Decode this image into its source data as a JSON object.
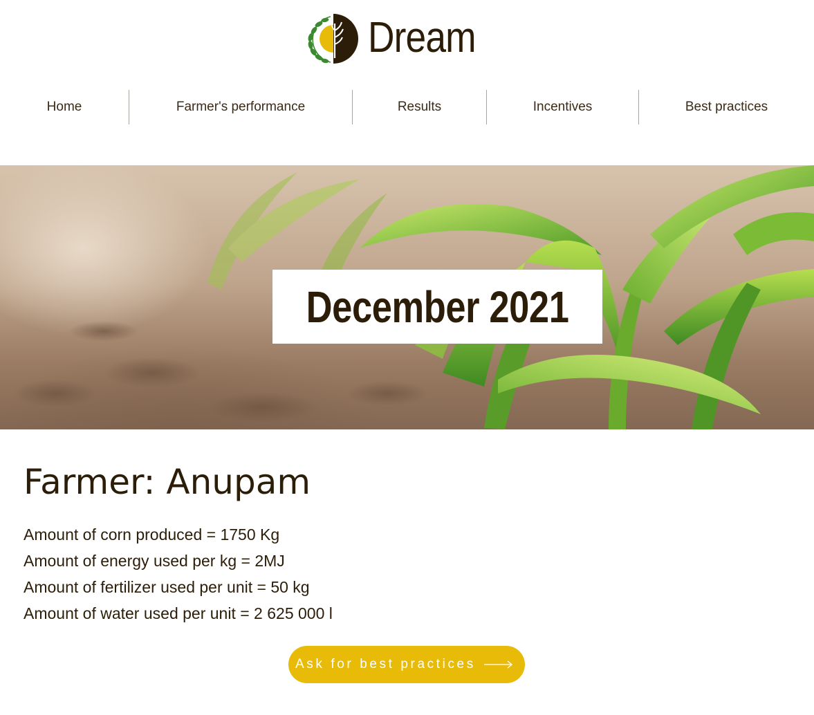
{
  "brand": {
    "name": "Dream",
    "logo_icon": "wheat-leaf-logo-icon",
    "colors": {
      "text": "#2c1d08",
      "accent_yellow": "#e8bb09",
      "leaf_green": "#3b8a2f",
      "dark_brown": "#2c1d08"
    }
  },
  "nav": {
    "items": [
      {
        "label": "Home"
      },
      {
        "label": "Farmer's performance"
      },
      {
        "label": "Results"
      },
      {
        "label": "Incentives"
      },
      {
        "label": "Best practices"
      }
    ]
  },
  "hero": {
    "label": "December 2021",
    "image": "corn-seedlings-photo"
  },
  "farmer": {
    "title": "Farmer: Anupam",
    "stats": [
      "Amount of corn produced = 1750 Kg",
      "Amount of energy used per kg = 2MJ",
      "Amount of fertilizer used per unit = 50 kg",
      "Amount of water used per unit = 2 625 000 l"
    ]
  },
  "cta": {
    "label": "Ask for best practices",
    "icon": "arrow-right-icon"
  }
}
